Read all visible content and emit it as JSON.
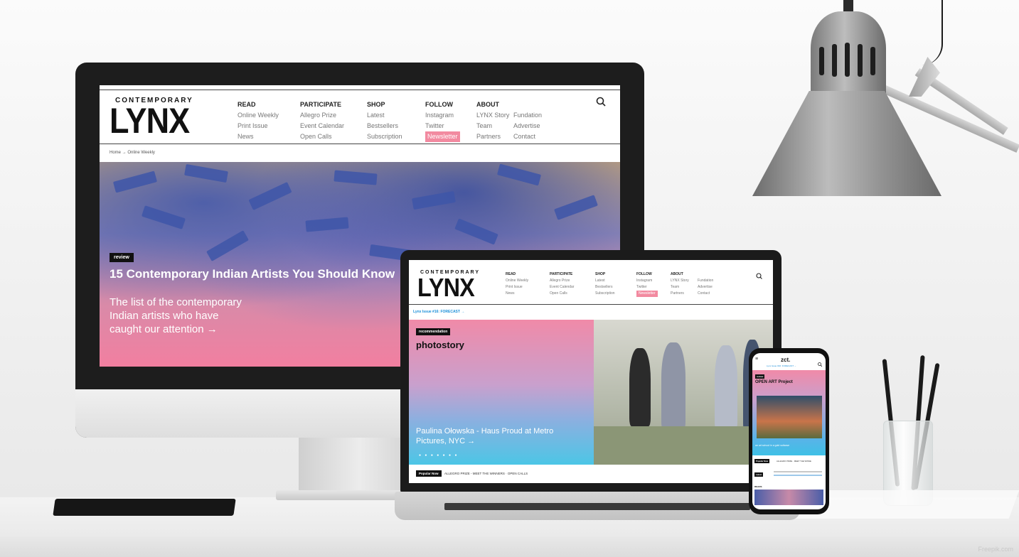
{
  "desktop": {
    "logo_small": "CONTEMPORARY",
    "logo_big": "LYNX",
    "nav": [
      {
        "title": "READ",
        "items": [
          "Online Weekly",
          "Print Issue",
          "News"
        ]
      },
      {
        "title": "PARTICIPATE",
        "items": [
          "Allegro Prize",
          "Event Calendar",
          "Open Calls"
        ]
      },
      {
        "title": "SHOP",
        "items": [
          "Latest",
          "Bestsellers",
          "Subscription"
        ]
      },
      {
        "title": "FOLLOW",
        "items": [
          "Instagram",
          "Twitter",
          "Newsletter"
        ]
      },
      {
        "title": "ABOUT",
        "items": [
          "LYNX Story",
          "Team",
          "Partners"
        ]
      },
      {
        "title": "",
        "items": [
          "Fundation",
          "Advertise",
          "Contact"
        ]
      }
    ],
    "breadcrumb": "Home → Online Weekly",
    "tag": "review",
    "hero_title": "15 Contemporary Indian Artists You Should Know",
    "hero_sub_line1": "The list of the contemporary",
    "hero_sub_line2": "Indian artists who have",
    "hero_sub_line3": "caught our attention →"
  },
  "laptop": {
    "logo_small": "CONTEMPORARY",
    "logo_big": "LYNX",
    "nav": [
      {
        "title": "READ",
        "items": [
          "Online Weekly",
          "Print Issue",
          "News"
        ]
      },
      {
        "title": "PARTICIPATE",
        "items": [
          "Allegro Prize",
          "Event Calendar",
          "Open Calls"
        ]
      },
      {
        "title": "SHOP",
        "items": [
          "Latest",
          "Bestsellers",
          "Subscription"
        ]
      },
      {
        "title": "FOLLOW",
        "items": [
          "Instagram",
          "Twitter",
          "Newsletter"
        ]
      },
      {
        "title": "ABOUT",
        "items": [
          "LYNX Story",
          "Team",
          "Partners"
        ]
      },
      {
        "title": "",
        "items": [
          "Fundation",
          "Advertise",
          "Contact"
        ]
      }
    ],
    "issue_link": "Lynx Issue #16: FORECAST →",
    "tag": "recommendation",
    "hero_label": "photostory",
    "hero_title_line1": "Paulina Ołowska - Haus Proud at Metro",
    "hero_title_line2": "Pictures, NYC →",
    "popular_label": "Popular Now",
    "popular_items": "ALLEGRO PRIZE - MEET THE WINNERS · OPEN CALLS"
  },
  "phone": {
    "logo": "zct.",
    "issue_link": "Lynx Issue #16: FORECAST →",
    "tag": "review",
    "title": "OPEN ART Project",
    "caption": "an art school in a gold suitcase",
    "popular_label": "Popular Now",
    "popular_items": "ALLEGRO PRIZE · MEET THE WINNE",
    "latest_label": "Latest",
    "section_label": "READS"
  },
  "watermark": "Freepik.com",
  "colors": {
    "accent_pink": "#f28aa0",
    "link_blue": "#1a8fd8",
    "tag_black": "#111111"
  }
}
